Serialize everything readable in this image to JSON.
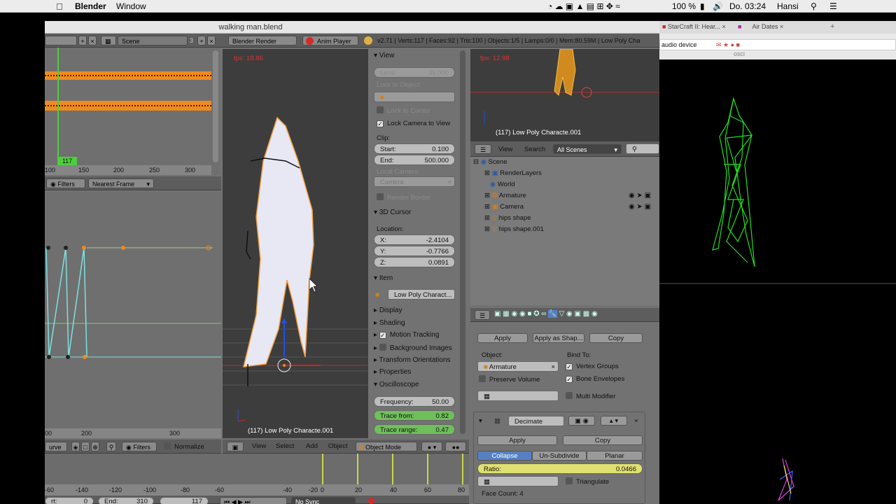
{
  "menubar": {
    "app": "Blender",
    "window": "Window",
    "battery": "100 %",
    "clock": "Do. 03:24",
    "user": "Hansi"
  },
  "window_title": "walking man.blend",
  "browser": {
    "tab1": "StarCraft II: Hear...",
    "tab2": "Air Dates",
    "address": "audio device",
    "addr_suggestion": "osci"
  },
  "info_header": {
    "scene": "Scene",
    "scene_users": "3",
    "engine": "Blender Render",
    "anim_player": "Anim Player",
    "stats": "v2.71 | Verts:117 | Faces:92 | Tris:100 | Objects:1/5 | Lamps:0/0 | Mem:80.59M | Low Poly Cha"
  },
  "dopesheet": {
    "current_frame": "117",
    "ticks": [
      "100",
      "150",
      "200",
      "250",
      "300"
    ],
    "filters": "Filters",
    "snap": "Nearest Frame"
  },
  "graph_editor": {
    "ticks": [
      "00",
      "200",
      "300"
    ],
    "mode": "urve",
    "filters": "Filters",
    "normalize": "Normalize"
  },
  "viewport": {
    "fps": "fps: 18.86",
    "object_label": "(117) Low Poly Characte.001",
    "menu_view": "View",
    "menu_select": "Select",
    "menu_add": "Add",
    "menu_object": "Object",
    "mode": "Object Mode"
  },
  "properties_panel": {
    "view_header": "View",
    "lens_label": "Lens:",
    "lens_value": "35.000",
    "lock_to_object": "Lock to Object:",
    "lock_to_cursor": "Lock to Cursor",
    "lock_camera_to_view": "Lock Camera to View",
    "clip_label": "Clip:",
    "clip_start_label": "Start:",
    "clip_start_value": "0.100",
    "clip_end_label": "End:",
    "clip_end_value": "500.000",
    "local_camera": "Local Camera:",
    "camera_field": "Camera",
    "render_border": "Render Border",
    "cursor_header": "3D Cursor",
    "location_label": "Location:",
    "x_label": "X:",
    "x_value": "-2.4104",
    "y_label": "Y:",
    "y_value": "-0.7766",
    "z_label": "Z:",
    "z_value": "0.0891",
    "item_header": "Item",
    "item_name": "Low Poly Charact...",
    "display": "Display",
    "shading": "Shading",
    "motion_tracking": "Motion Tracking",
    "background_images": "Background Images",
    "transform_orientations": "Transform Orientations",
    "properties": "Properties",
    "oscilloscope": "Oscilloscope",
    "frequency_label": "Frequency:",
    "frequency_value": "50.00",
    "trace_from_label": "Trace from:",
    "trace_from_value": "0.82",
    "trace_range_label": "Trace range:",
    "trace_range_value": "0.47"
  },
  "camera_view": {
    "fps": "fps: 12.98",
    "object_label": "(117) Low Poly Characte.001"
  },
  "outliner": {
    "view": "View",
    "search": "Search",
    "scenes": "All Scenes",
    "items": [
      "Scene",
      "RenderLayers",
      "World",
      "Armature",
      "Camera",
      "hips shape",
      "hips shape.001"
    ]
  },
  "modifiers": {
    "apply": "Apply",
    "apply_as_shape": "Apply as Shap...",
    "copy": "Copy",
    "object_label": "Object:",
    "object_value": "Armature",
    "bind_to": "Bind To:",
    "vertex_groups": "Vertex Groups",
    "bone_envelopes": "Bone Envelopes",
    "preserve_volume": "Preserve Volume",
    "multi_modifier": "Multi Modifier",
    "decimate": "Decimate",
    "apply2": "Apply",
    "copy2": "Copy",
    "collapse": "Collapse",
    "unsubdivide": "Un-Subdivide",
    "planar": "Planar",
    "ratio_label": "Ratio:",
    "ratio_value": "0.0466",
    "triangulate": "Triangulate",
    "face_count": "Face Count: 4"
  },
  "timeline": {
    "ticks": [
      "-60",
      "-140",
      "-120",
      "-100",
      "-80",
      "-60",
      "-40",
      "-20",
      "0",
      "20",
      "40",
      "60",
      "80"
    ],
    "start_label": "rt:",
    "start_value": "0",
    "end_label": "End:",
    "end_value": "310",
    "frame": "117",
    "sync": "No Sync"
  },
  "colors": {
    "orange": "#f08a1e",
    "green_keys": "#c8d64a",
    "wire_green": "#22e022",
    "selected_blue": "#5680c2"
  }
}
